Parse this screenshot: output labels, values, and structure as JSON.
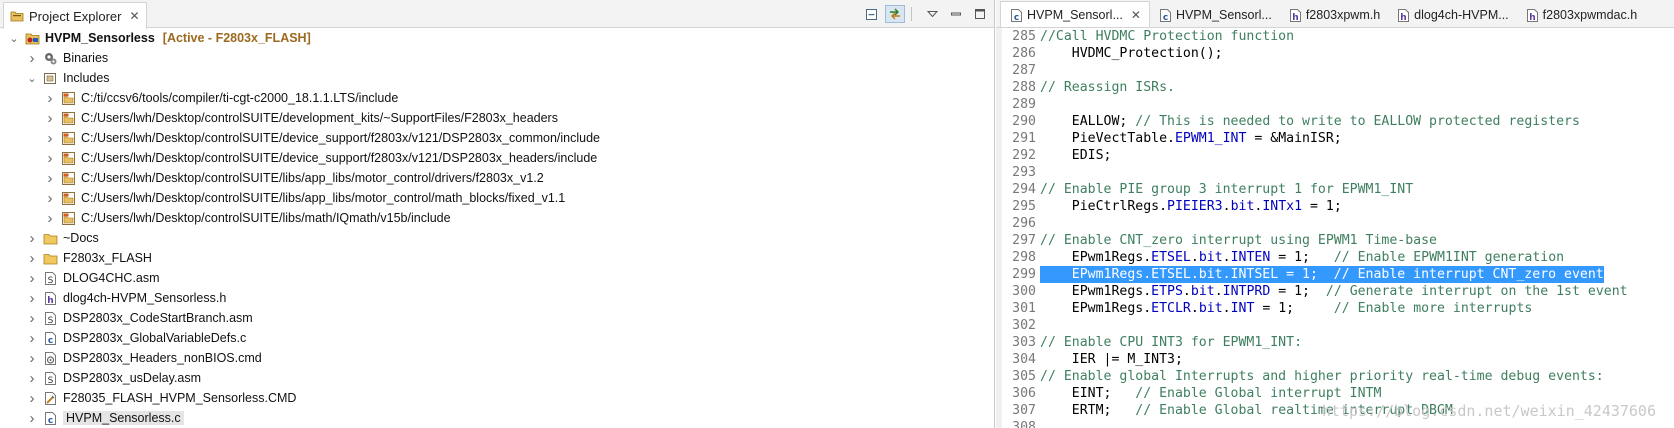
{
  "explorer": {
    "tab_label": "Project Explorer",
    "project": {
      "name": "HVPM_Sensorless",
      "active_tag": "[Active - F2803x_FLASH]"
    },
    "items": [
      {
        "label": "Binaries",
        "indent": 1,
        "expanded": false,
        "icon": "binaries-icon"
      },
      {
        "label": "Includes",
        "indent": 1,
        "expanded": true,
        "icon": "includes-icon"
      },
      {
        "label": "C:/ti/ccsv6/tools/compiler/ti-cgt-c2000_18.1.1.LTS/include",
        "indent": 2,
        "expanded": false,
        "icon": "include-folder-icon"
      },
      {
        "label": "C:/Users/lwh/Desktop/controlSUITE/development_kits/~SupportFiles/F2803x_headers",
        "indent": 2,
        "expanded": false,
        "icon": "include-folder-icon"
      },
      {
        "label": "C:/Users/lwh/Desktop/controlSUITE/device_support/f2803x/v121/DSP2803x_common/include",
        "indent": 2,
        "expanded": false,
        "icon": "include-folder-icon"
      },
      {
        "label": "C:/Users/lwh/Desktop/controlSUITE/device_support/f2803x/v121/DSP2803x_headers/include",
        "indent": 2,
        "expanded": false,
        "icon": "include-folder-icon"
      },
      {
        "label": "C:/Users/lwh/Desktop/controlSUITE/libs/app_libs/motor_control/drivers/f2803x_v1.2",
        "indent": 2,
        "expanded": false,
        "icon": "include-folder-icon"
      },
      {
        "label": "C:/Users/lwh/Desktop/controlSUITE/libs/app_libs/motor_control/math_blocks/fixed_v1.1",
        "indent": 2,
        "expanded": false,
        "icon": "include-folder-icon"
      },
      {
        "label": "C:/Users/lwh/Desktop/controlSUITE/libs/math/IQmath/v15b/include",
        "indent": 2,
        "expanded": false,
        "icon": "include-folder-icon"
      },
      {
        "label": "~Docs",
        "indent": 1,
        "expanded": false,
        "icon": "folder-icon"
      },
      {
        "label": "F2803x_FLASH",
        "indent": 1,
        "expanded": false,
        "icon": "folder-icon"
      },
      {
        "label": "DLOG4CHC.asm",
        "indent": 1,
        "expanded": false,
        "icon": "asm-file-icon"
      },
      {
        "label": "dlog4ch-HVPM_Sensorless.h",
        "indent": 1,
        "expanded": false,
        "icon": "header-file-icon"
      },
      {
        "label": "DSP2803x_CodeStartBranch.asm",
        "indent": 1,
        "expanded": false,
        "icon": "asm-file-icon"
      },
      {
        "label": "DSP2803x_GlobalVariableDefs.c",
        "indent": 1,
        "expanded": false,
        "icon": "c-file-icon"
      },
      {
        "label": "DSP2803x_Headers_nonBIOS.cmd",
        "indent": 1,
        "expanded": false,
        "icon": "cmd-file-icon"
      },
      {
        "label": "DSP2803x_usDelay.asm",
        "indent": 1,
        "expanded": false,
        "icon": "asm-file-icon"
      },
      {
        "label": "F28035_FLASH_HVPM_Sensorless.CMD",
        "indent": 1,
        "expanded": false,
        "icon": "linker-cmd-icon"
      },
      {
        "label": "HVPM_Sensorless.c",
        "indent": 1,
        "expanded": false,
        "icon": "c-file-icon",
        "selected": true
      }
    ]
  },
  "editor": {
    "tabs": [
      {
        "label": "HVPM_Sensorl...",
        "icon": "c-file-icon",
        "active": true,
        "closable": true
      },
      {
        "label": "HVPM_Sensorl...",
        "icon": "c-file-icon"
      },
      {
        "label": "f2803xpwm.h",
        "icon": "header-file-icon"
      },
      {
        "label": "dlog4ch-HVPM...",
        "icon": "header-file-icon"
      },
      {
        "label": "f2803xpwmdac.h",
        "icon": "header-file-icon"
      }
    ],
    "lines": [
      {
        "n": "285",
        "parts": [
          {
            "t": "//Call HVDMC Protection function",
            "k": "c"
          }
        ]
      },
      {
        "n": "286",
        "parts": [
          {
            "t": "    HVDMC_Protection();"
          }
        ]
      },
      {
        "n": "287",
        "parts": []
      },
      {
        "n": "288",
        "parts": [
          {
            "t": "// Reassign ISRs.",
            "k": "c"
          }
        ]
      },
      {
        "n": "289",
        "parts": []
      },
      {
        "n": "290",
        "parts": [
          {
            "t": "    EALLOW; "
          },
          {
            "t": "// This is needed to write to EALLOW protected registers",
            "k": "c"
          }
        ]
      },
      {
        "n": "291",
        "parts": [
          {
            "t": "    PieVectTable."
          },
          {
            "t": "EPWM1_INT",
            "k": "m"
          },
          {
            "t": " = &MainISR;"
          }
        ]
      },
      {
        "n": "292",
        "parts": [
          {
            "t": "    EDIS;"
          }
        ]
      },
      {
        "n": "293",
        "parts": []
      },
      {
        "n": "294",
        "parts": [
          {
            "t": "// Enable PIE group 3 interrupt 1 for EPWM1_INT",
            "k": "c"
          }
        ]
      },
      {
        "n": "295",
        "parts": [
          {
            "t": "    PieCtrlRegs."
          },
          {
            "t": "PIEIER3",
            "k": "m"
          },
          {
            "t": "."
          },
          {
            "t": "bit",
            "k": "m"
          },
          {
            "t": "."
          },
          {
            "t": "INTx1",
            "k": "m"
          },
          {
            "t": " = 1;"
          }
        ]
      },
      {
        "n": "296",
        "parts": []
      },
      {
        "n": "297",
        "parts": [
          {
            "t": "// Enable CNT_zero interrupt using EPWM1 Time-base",
            "k": "c"
          }
        ]
      },
      {
        "n": "298",
        "parts": [
          {
            "t": "    EPwm1Regs."
          },
          {
            "t": "ETSEL",
            "k": "m"
          },
          {
            "t": "."
          },
          {
            "t": "bit",
            "k": "m"
          },
          {
            "t": "."
          },
          {
            "t": "INTEN",
            "k": "m"
          },
          {
            "t": " = 1;   "
          },
          {
            "t": "// Enable EPWM1INT generation",
            "k": "c"
          }
        ]
      },
      {
        "n": "299",
        "highlight": true,
        "parts": [
          {
            "t": "    EPwm1Regs.ETSEL.bit.INTSEL = 1;  // Enable interrupt CNT_zero event"
          }
        ]
      },
      {
        "n": "300",
        "parts": [
          {
            "t": "    EPwm1Regs."
          },
          {
            "t": "ETPS",
            "k": "m"
          },
          {
            "t": "."
          },
          {
            "t": "bit",
            "k": "m"
          },
          {
            "t": "."
          },
          {
            "t": "INTPRD",
            "k": "m"
          },
          {
            "t": " = 1;  "
          },
          {
            "t": "// Generate interrupt on the 1st event",
            "k": "c"
          }
        ]
      },
      {
        "n": "301",
        "parts": [
          {
            "t": "    EPwm1Regs."
          },
          {
            "t": "ETCLR",
            "k": "m"
          },
          {
            "t": "."
          },
          {
            "t": "bit",
            "k": "m"
          },
          {
            "t": "."
          },
          {
            "t": "INT",
            "k": "m"
          },
          {
            "t": " = 1;     "
          },
          {
            "t": "// Enable more interrupts",
            "k": "c"
          }
        ]
      },
      {
        "n": "302",
        "parts": []
      },
      {
        "n": "303",
        "parts": [
          {
            "t": "// Enable CPU INT3 for EPWM1_INT:",
            "k": "c"
          }
        ]
      },
      {
        "n": "304",
        "parts": [
          {
            "t": "    IER |= M_INT3;"
          }
        ]
      },
      {
        "n": "305",
        "parts": [
          {
            "t": "// Enable global Interrupts and higher priority real-time debug events:",
            "k": "c"
          }
        ]
      },
      {
        "n": "306",
        "parts": [
          {
            "t": "    EINT;   "
          },
          {
            "t": "// Enable Global interrupt INTM",
            "k": "c"
          }
        ]
      },
      {
        "n": "307",
        "parts": [
          {
            "t": "    ERTM;   "
          },
          {
            "t": "// Enable Global realtime interrupt DBGM",
            "k": "c"
          }
        ]
      },
      {
        "n": "308",
        "parts": []
      }
    ],
    "watermark": "https://blog.csdn.net/weixin_42437606"
  }
}
